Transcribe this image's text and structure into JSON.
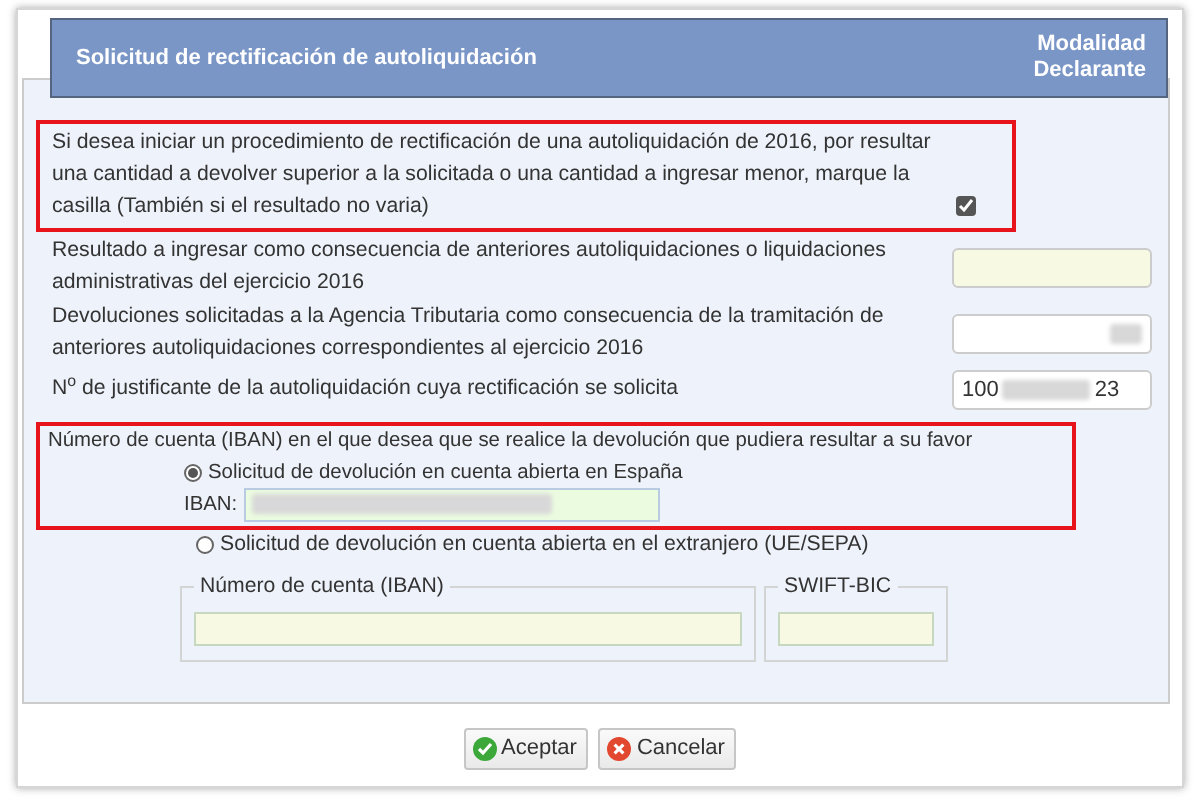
{
  "dialog": {
    "title": "Solicitud de rectificación de autoliquidación",
    "mode_lines": [
      "Modalidad",
      "Declarante"
    ]
  },
  "rectify": {
    "text": "Si desea iniciar un procedimiento de rectificación de una autoliquidación de 2016, por resultar una cantidad a devolver superior a la solicitada o una cantidad a ingresar menor, marque la casilla (También si el resultado no varia)",
    "checked": true,
    "highlighted": true
  },
  "fields": [
    {
      "label": "Resultado a ingresar como consecuencia de anteriores autoliquidaciones o liquidaciones administrativas del ejercicio 2016",
      "kind": "empty"
    },
    {
      "label": "Devoluciones solicitadas a la Agencia Tributaria como consecuencia de la tramitación de anteriores autoliquidaciones correspondientes al ejercicio 2016",
      "kind": "masked"
    },
    {
      "label": "N$^{o}$ de justificante de la autoliquidación cuya rectificación se solicita",
      "kind": "partial",
      "value_start": "100",
      "value_end": "23"
    }
  ],
  "account": {
    "heading": "Número de cuenta (IBAN) en el que desea que se realice la devolución que pudiera resultar a su favor",
    "highlighted": true,
    "options": [
      {
        "label": "Solicitud de devolución en cuenta abierta en España",
        "selected": true,
        "iban_label": "IBAN:"
      },
      {
        "label": "Solicitud de devolución en cuenta abierta en el extranjero (UE/SEPA)",
        "selected": false,
        "groups": [
          {
            "legend": "Número de cuenta (IBAN)"
          },
          {
            "legend": "SWIFT-BIC"
          }
        ]
      }
    ]
  },
  "buttons": [
    {
      "label": "Aceptar",
      "kind": "ok"
    },
    {
      "label": "Cancelar",
      "kind": "cancel"
    }
  ]
}
